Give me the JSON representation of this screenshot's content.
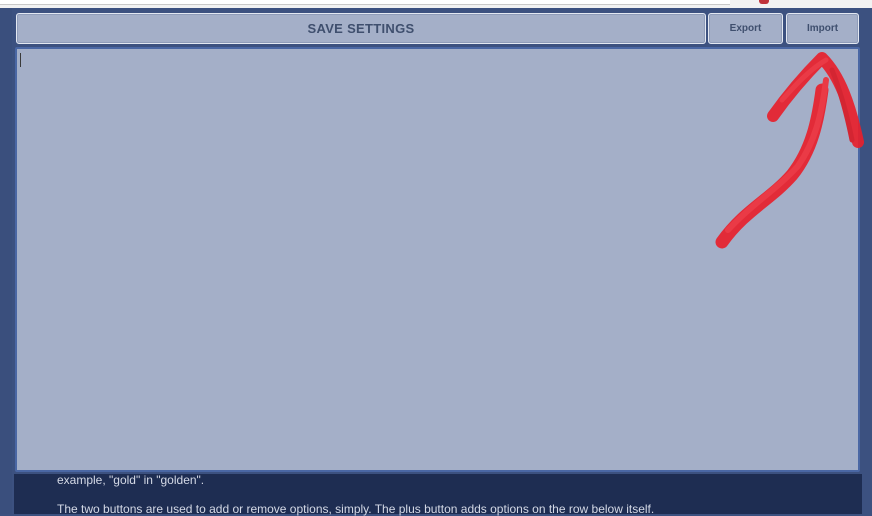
{
  "toolbar": {
    "save_label": "SAVE SETTINGS",
    "export_label": "Export",
    "import_label": "Import"
  },
  "settings_text": {
    "value": ""
  },
  "help": {
    "line1": "example, \"gold\" in \"golden\".",
    "line2": "The two buttons are used to add or remove options, simply. The plus button adds options on the row below itself."
  },
  "colors": {
    "background": "#3c5180",
    "button_fill": "#a4afc8",
    "help_panel": "#1e2d52",
    "annotation": "#e8202c"
  }
}
